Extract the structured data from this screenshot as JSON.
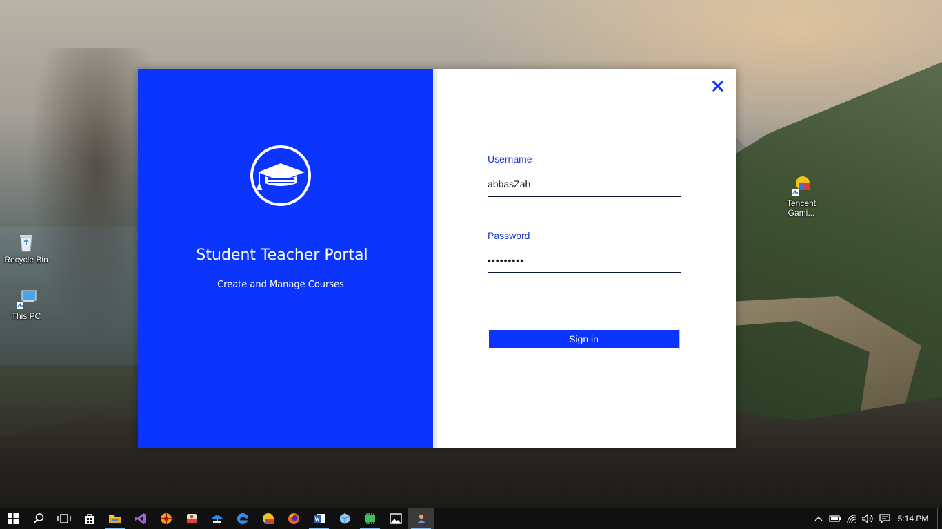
{
  "desktop": {
    "icons": [
      {
        "label": "Recycle Bin",
        "icon": "recycle-bin-icon"
      },
      {
        "label": "This PC",
        "icon": "computer-icon"
      },
      {
        "label": "Tencent Gami...",
        "icon": "tencent-gaming-icon"
      }
    ]
  },
  "login": {
    "app_title": "Student Teacher Portal",
    "app_subtitle": "Create and Manage Courses",
    "username_label": "Username",
    "username_value": "abbasZah",
    "password_label": "Password",
    "password_value": "abcdefghi",
    "signin_label": "Sign in",
    "close_icon": "close-icon",
    "logo_icon": "graduation-cap-icon"
  },
  "colors": {
    "accent": "#0b34fc",
    "label": "#1737d6"
  },
  "taskbar": {
    "items": [
      {
        "name": "start-icon"
      },
      {
        "name": "search-icon"
      },
      {
        "name": "task-view-icon"
      },
      {
        "name": "store-icon"
      },
      {
        "name": "file-explorer-icon"
      },
      {
        "name": "visual-studio-icon"
      },
      {
        "name": "app-icon-orange"
      },
      {
        "name": "app-icon-red"
      },
      {
        "name": "app-icon-umbrella"
      },
      {
        "name": "edge-icon"
      },
      {
        "name": "app-icon-yellow"
      },
      {
        "name": "firefox-icon"
      },
      {
        "name": "word-icon"
      },
      {
        "name": "app-icon-cube"
      },
      {
        "name": "app-icon-green"
      },
      {
        "name": "photos-icon"
      },
      {
        "name": "portal-app-icon"
      }
    ],
    "clock": "5:14 PM"
  }
}
